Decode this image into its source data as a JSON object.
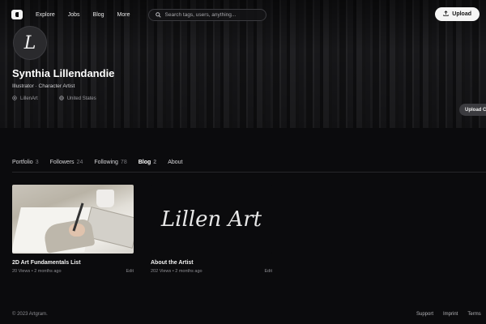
{
  "nav": {
    "logo": "artgram-logo",
    "links": [
      "Explore",
      "Jobs",
      "Blog",
      "More"
    ],
    "search_placeholder": "Search tags, users, anything...",
    "upload_label": "Upload"
  },
  "profile": {
    "avatar_letter": "L",
    "name": "Synthia Lillendandie",
    "role": "Illustrator · Character Artist",
    "handle": "LillenArt",
    "location": "United States",
    "upload_cover_label": "Upload C"
  },
  "tabs": [
    {
      "label": "Portfolio",
      "count": "3"
    },
    {
      "label": "Followers",
      "count": "24"
    },
    {
      "label": "Following",
      "count": "78"
    },
    {
      "label": "Blog",
      "count": "2",
      "active": true
    },
    {
      "label": "About",
      "count": ""
    }
  ],
  "posts": [
    {
      "title": "2D Art Fundamentals List",
      "views": "20 Views",
      "date": "2 months ago",
      "edit": "Edit"
    },
    {
      "title": "About the Artist",
      "views": "202 Views",
      "date": "2 months ago",
      "edit": "Edit",
      "logo_text": "Lillen Art"
    }
  ],
  "footer": {
    "copyright": "© 2023 Artgram.",
    "links": [
      "Support",
      "Imprint",
      "Terms"
    ]
  },
  "colors": {
    "background": "#0b0b0d",
    "text": "#e6e6e6",
    "muted": "#8d8d92",
    "button": "#f5f5f5"
  }
}
